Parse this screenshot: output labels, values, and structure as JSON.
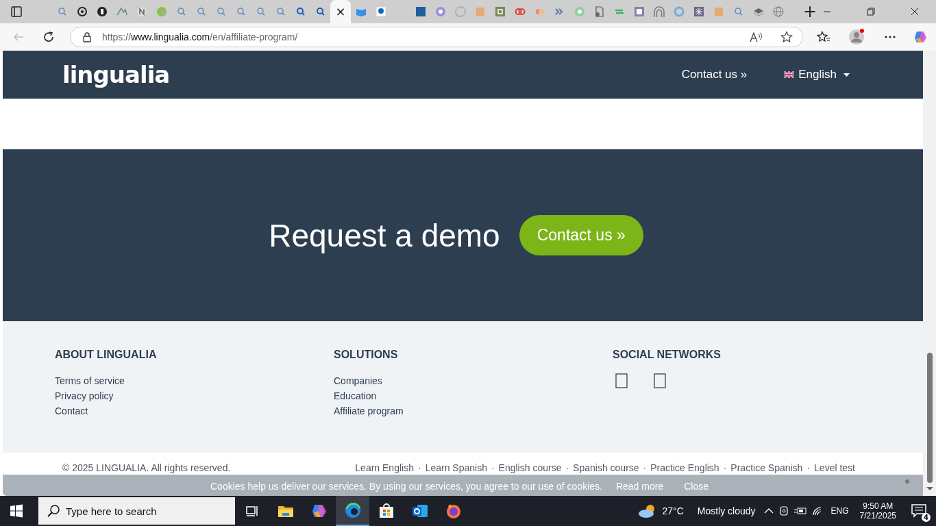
{
  "browser": {
    "tabs": [
      {
        "selected": false
      },
      {
        "selected": false
      },
      {
        "selected": false
      },
      {
        "selected": false
      },
      {
        "selected": false
      },
      {
        "selected": false
      },
      {
        "selected": false
      },
      {
        "selected": false
      },
      {
        "selected": false
      },
      {
        "selected": false
      },
      {
        "selected": false
      },
      {
        "selected": false
      },
      {
        "selected": false
      },
      {
        "selected": false
      },
      {
        "selected": true,
        "close": "×"
      },
      {
        "selected": false
      },
      {
        "selected": false
      },
      {
        "selected": false
      },
      {
        "selected": false
      },
      {
        "selected": false
      },
      {
        "selected": false
      },
      {
        "selected": false
      },
      {
        "selected": false
      },
      {
        "selected": false
      },
      {
        "selected": false
      },
      {
        "selected": false
      },
      {
        "selected": false
      },
      {
        "selected": false
      },
      {
        "selected": false
      },
      {
        "selected": false
      },
      {
        "selected": false
      },
      {
        "selected": false
      },
      {
        "selected": false
      },
      {
        "selected": false
      },
      {
        "selected": false
      },
      {
        "selected": false
      },
      {
        "selected": false
      }
    ],
    "new_tab": "+",
    "url": {
      "scheme": "https://",
      "host": "www.lingualia.com",
      "path": "/en/affiliate-program/"
    }
  },
  "header": {
    "logo": "lingualia",
    "nav": [
      {
        "kind": "link",
        "label": "Contact us »"
      },
      {
        "kind": "language",
        "label": "English"
      }
    ]
  },
  "demo": {
    "title": "Request a demo",
    "button": "Contact us »"
  },
  "footer": {
    "columns": [
      {
        "heading": "ABOUT LINGUALIA",
        "links": [
          "Terms of service",
          "Privacy policy",
          "Contact"
        ]
      },
      {
        "heading": "SOLUTIONS",
        "links": [
          "Companies",
          "Education",
          "Affiliate program"
        ]
      },
      {
        "heading": "SOCIAL NETWORKS",
        "social": [
          {
            "kind": "missing-glyph"
          },
          {
            "kind": "missing-glyph"
          }
        ]
      }
    ]
  },
  "bottom": {
    "copyright": "© 2025 LINGUALIA. All rights reserved.",
    "links": [
      "Learn English",
      "Learn Spanish",
      "English course",
      "Spanish course",
      "Practice English",
      "Practice Spanish",
      "Level test"
    ],
    "separator": "·"
  },
  "cookie": {
    "text": "Cookies help us deliver our services. By using our services, you agree to our use of cookies.",
    "read_more": "Read more",
    "close": "Close"
  },
  "taskbar": {
    "search_placeholder": "Type here to search",
    "temperature": "27°C",
    "weather": "Mostly cloudy",
    "language": "ENG",
    "time": "9:50 AM",
    "date": "7/21/2025",
    "notifications": "4"
  }
}
